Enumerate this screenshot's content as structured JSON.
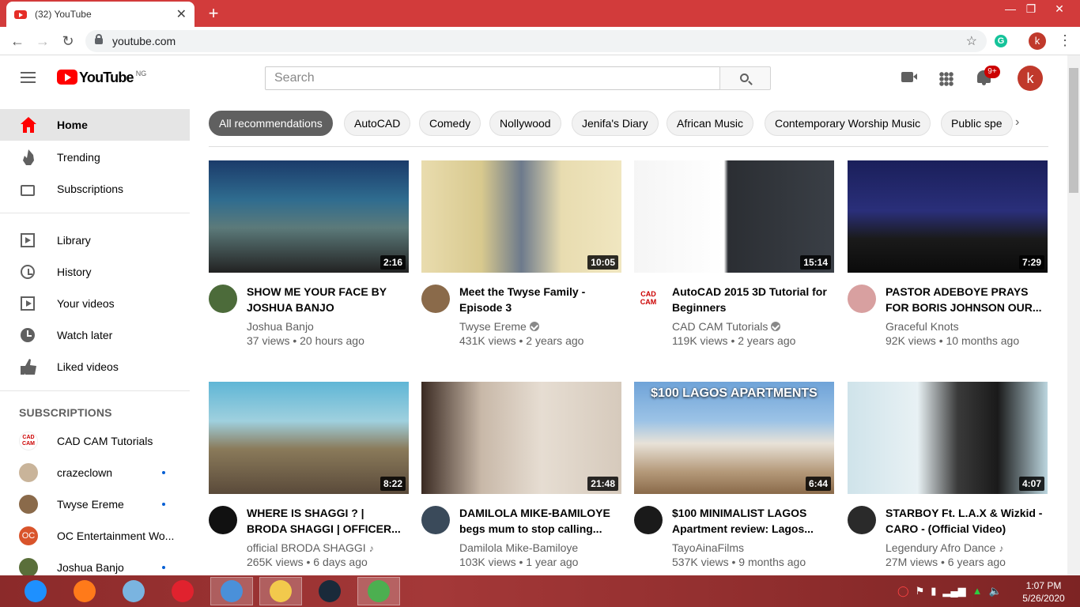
{
  "browser": {
    "tab_title": "(32) YouTube",
    "tab_close": "✕",
    "new_tab": "+",
    "url": "youtube.com",
    "profile_initial": "k",
    "window_controls": [
      "—",
      "❐",
      "✕"
    ]
  },
  "header": {
    "logo_text": "YouTube",
    "country_code": "NG",
    "search_placeholder": "Search",
    "notification_count": "9+",
    "avatar_initial": "k"
  },
  "sidebar": {
    "primary": [
      {
        "label": "Home",
        "icon": "home-icon",
        "active": true
      },
      {
        "label": "Trending",
        "icon": "trending-icon"
      },
      {
        "label": "Subscriptions",
        "icon": "subscriptions-icon"
      }
    ],
    "secondary": [
      {
        "label": "Library",
        "icon": "library-icon"
      },
      {
        "label": "History",
        "icon": "history-icon"
      },
      {
        "label": "Your videos",
        "icon": "your-videos-icon"
      },
      {
        "label": "Watch later",
        "icon": "watch-later-icon"
      },
      {
        "label": "Liked videos",
        "icon": "liked-videos-icon"
      }
    ],
    "subscriptions_heading": "SUBSCRIPTIONS",
    "subscriptions": [
      {
        "name": "CAD CAM Tutorials",
        "new": false,
        "color": "#ffffff"
      },
      {
        "name": "crazeclown",
        "new": true,
        "color": "#c9b49a"
      },
      {
        "name": "Twyse Ereme",
        "new": true,
        "color": "#8a6a4a"
      },
      {
        "name": "OC Entertainment Wo...",
        "new": false,
        "color": "#d9542b",
        "initials": "OC"
      },
      {
        "name": "Joshua Banjo",
        "new": true,
        "color": "#5a6f3a"
      }
    ]
  },
  "chips": [
    "All recommendations",
    "AutoCAD",
    "Comedy",
    "Nollywood",
    "Jenifa's Diary",
    "African Music",
    "Contemporary Worship Music",
    "Public spe"
  ],
  "videos": [
    {
      "title": "SHOW ME YOUR FACE BY JOSHUA BANJO",
      "channel": "Joshua Banjo",
      "verified": false,
      "music": false,
      "meta": "37 views • 20 hours ago",
      "duration": "2:16",
      "thumb": "linear-gradient(180deg,#1b3b6a 0%,#2f6c8f 35%,#5c7a7a 60%,#222 100%)",
      "avatar": "#4c6b3a"
    },
    {
      "title": "Meet the Twyse Family - Episode 3",
      "channel": "Twyse Ereme",
      "verified": true,
      "music": false,
      "meta": "431K views • 2 years ago",
      "duration": "10:05",
      "thumb": "linear-gradient(90deg,#e9dcae 0%,#d8c98e 30%,#6d7a8c 50%,#e8dcb0 70%,#f0e6c0 100%)",
      "avatar": "#8a6a4a"
    },
    {
      "title": "AutoCAD 2015 3D Tutorial for Beginners",
      "channel": "CAD CAM Tutorials",
      "verified": true,
      "music": false,
      "meta": "119K views • 2 years ago",
      "duration": "15:14",
      "thumb": "linear-gradient(90deg,#f5f5f5 0%,#ffffff 45%,#2b2e33 47%,#3a3f46 100%)",
      "avatar": "#ffffff",
      "avatar_text": "CAD CAM"
    },
    {
      "title": "PASTOR ADEBOYE PRAYS FOR BORIS JOHNSON OUR...",
      "channel": "Graceful Knots",
      "verified": false,
      "music": false,
      "meta": "92K views • 10 months ago",
      "duration": "7:29",
      "thumb": "linear-gradient(180deg,#1a1f5a 0%,#2a2f7a 45%,#1a1a1a 70%,#0b0b0b 100%)",
      "avatar": "#d8a0a0"
    },
    {
      "title": "WHERE IS SHAGGI ? | BRODA SHAGGI | OFFICER...",
      "channel": "official BRODA SHAGGI",
      "verified": false,
      "music": true,
      "meta": "265K views • 6 days ago",
      "duration": "8:22",
      "thumb": "linear-gradient(180deg,#5fb6d6 0%,#9fd0de 35%,#8a7a5a 60%,#5a4a3a 100%)",
      "avatar": "#111111"
    },
    {
      "title": "DAMILOLA MIKE-BAMILOYE begs mum to stop calling...",
      "channel": "Damilola Mike-Bamiloye",
      "verified": false,
      "music": false,
      "meta": "103K views • 1 year ago",
      "duration": "21:48",
      "thumb": "linear-gradient(90deg,#3a2a22 0%,#c8b8a8 30%,#e6ddd2 60%,#d6cabc 100%)",
      "avatar": "#3a4a5a"
    },
    {
      "title": "$100 MINIMALIST LAGOS Apartment review: Lagos...",
      "channel": "TayoAinaFilms",
      "verified": false,
      "music": false,
      "meta": "537K views • 9 months ago",
      "duration": "6:44",
      "thumb": "linear-gradient(180deg,#6fa3d8 0%,#9cc3e6 35%,#e8e2d8 55%,#b59a7a 80%,#8a6a4a 100%)",
      "avatar": "#1a1a1a",
      "overlay": "$100 LAGOS APARTMENTS"
    },
    {
      "title": "STARBOY Ft. L.A.X & Wizkid - CARO - (Official Video)",
      "channel": "Legendury Afro Dance",
      "verified": false,
      "music": true,
      "meta": "27M views • 6 years ago",
      "duration": "4:07",
      "thumb": "linear-gradient(90deg,#cfe3ea 0%,#e8f1f4 35%,#3a3a3a 55%,#1a1a1a 75%,#bcd6df 100%)",
      "avatar": "#2a2a2a"
    }
  ],
  "taskbar": {
    "time": "1:07 PM",
    "date": "5/26/2020",
    "apps": [
      {
        "name": "internet-explorer",
        "color": "#1e90ff",
        "open": false
      },
      {
        "name": "firefox",
        "color": "#ff7a1a",
        "open": false
      },
      {
        "name": "notepad",
        "color": "#7ab4e0",
        "open": false
      },
      {
        "name": "opera",
        "color": "#e0222e",
        "open": false
      },
      {
        "name": "media-player",
        "color": "#4a90d9",
        "open": true
      },
      {
        "name": "file-explorer",
        "color": "#f2c94c",
        "open": true
      },
      {
        "name": "nox",
        "color": "#1a2a3a",
        "open": false
      },
      {
        "name": "chrome",
        "color": "#4caf50",
        "open": true
      }
    ]
  }
}
